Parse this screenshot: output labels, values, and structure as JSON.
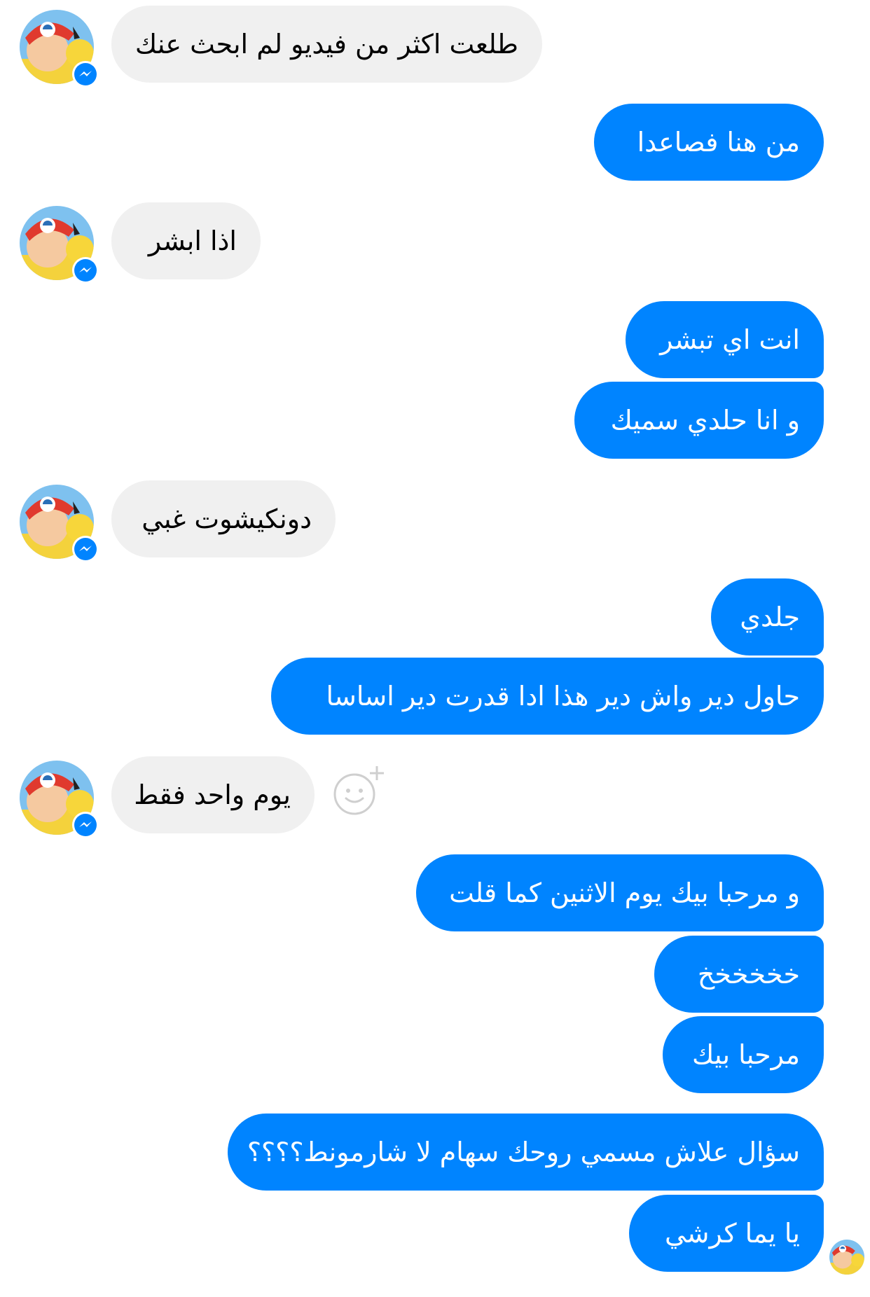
{
  "colors": {
    "incoming_bubble": "#f0f0f0",
    "outgoing_bubble": "#0084ff",
    "messenger_badge": "#0084ff"
  },
  "icons": {
    "avatar": "avatar-ash-pikachu",
    "badge": "messenger-icon",
    "reaction": "add-reaction-smiley-icon"
  },
  "messages": [
    {
      "dir": "in",
      "text": "طلعت اكثر من فيديو لم ابحث عنك"
    },
    {
      "dir": "out",
      "text": "من هنا فصاعدا"
    },
    {
      "dir": "in",
      "text": "اذا ابشر"
    },
    {
      "dir": "out",
      "text": "انت اي تبشر"
    },
    {
      "dir": "out",
      "text": "و انا حلدي سميك"
    },
    {
      "dir": "in",
      "text": "دونكيشوت غبي"
    },
    {
      "dir": "out",
      "text": "جلدي"
    },
    {
      "dir": "out",
      "text": "حاول دير واش دير هذا ادا قدرت دير اساسا"
    },
    {
      "dir": "in",
      "text": "يوم واحد فقط"
    },
    {
      "dir": "out",
      "text": "و مرحبا بيك يوم الاثنين كما قلت"
    },
    {
      "dir": "out",
      "text": "خخخخخخ"
    },
    {
      "dir": "out",
      "text": "مرحبا بيك"
    },
    {
      "dir": "out",
      "text": "سؤال علاش مسمي روحك سهام لا شارمونط؟؟؟؟"
    },
    {
      "dir": "out",
      "text": "يا يما كرشي"
    }
  ]
}
